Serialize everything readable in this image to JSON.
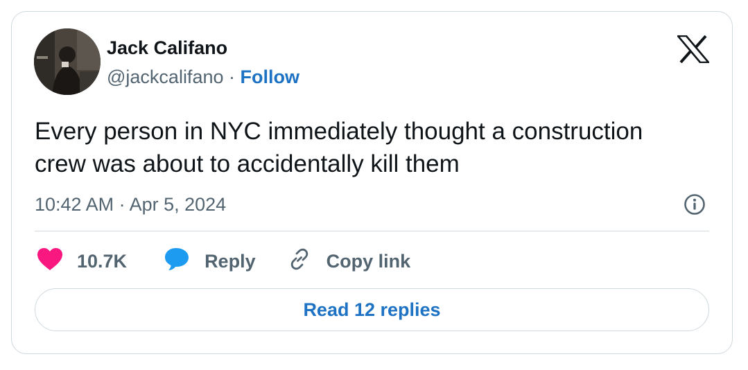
{
  "author": {
    "name": "Jack Califano",
    "handle": "@jackcalifano",
    "separator": "·",
    "follow_label": "Follow"
  },
  "tweet": {
    "text": "Every person in NYC immediately thought a construction crew was about to accidentally kill them",
    "timestamp": "10:42 AM · Apr 5, 2024"
  },
  "actions": {
    "likes": "10.7K",
    "reply_label": "Reply",
    "copy_label": "Copy link"
  },
  "read_replies_label": "Read 12 replies",
  "icons": {
    "logo": "x-logo-icon",
    "info": "info-icon",
    "like": "heart-icon",
    "reply": "speech-bubble-icon",
    "copy": "link-icon"
  },
  "colors": {
    "link_blue": "#1d72c4",
    "like_pink": "#f91880",
    "reply_blue": "#1d9bf0",
    "secondary_text": "#536471",
    "border": "#cfd9de"
  }
}
